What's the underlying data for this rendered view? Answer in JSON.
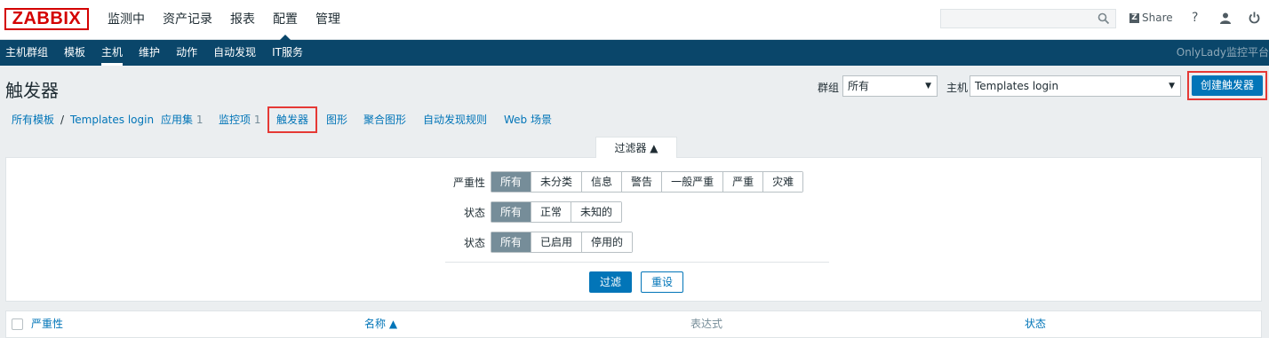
{
  "app": {
    "logo": "ZABBIX",
    "brand_label": "OnlyLady监控平台"
  },
  "top_menu": [
    {
      "label": "监测中"
    },
    {
      "label": "资产记录"
    },
    {
      "label": "报表"
    },
    {
      "label": "配置",
      "active": true
    },
    {
      "label": "管理"
    }
  ],
  "top_right": {
    "search_value": "",
    "share_label": "Share",
    "help_label": "?"
  },
  "sub_menu": [
    {
      "label": "主机群组"
    },
    {
      "label": "模板"
    },
    {
      "label": "主机",
      "active": true
    },
    {
      "label": "维护"
    },
    {
      "label": "动作"
    },
    {
      "label": "自动发现"
    },
    {
      "label": "IT服务"
    }
  ],
  "page": {
    "title": "触发器",
    "group_label": "群组",
    "group_value": "所有",
    "host_label": "主机",
    "host_value": "Templates login",
    "create_button": "创建触发器"
  },
  "breadcrumb": {
    "all_templates": "所有模板",
    "separator": "/",
    "template_name": "Templates login",
    "tabs": [
      {
        "label": "应用集",
        "count": "1"
      },
      {
        "label": "监控项",
        "count": "1"
      },
      {
        "label": "触发器",
        "count": "",
        "active": true
      },
      {
        "label": "图形",
        "count": ""
      },
      {
        "label": "聚合图形",
        "count": ""
      },
      {
        "label": "自动发现规则",
        "count": ""
      },
      {
        "label": "Web 场景",
        "count": ""
      }
    ]
  },
  "filter": {
    "tab_label": "过滤器 ▲",
    "severity": {
      "label": "严重性",
      "options": [
        "所有",
        "未分类",
        "信息",
        "警告",
        "一般严重",
        "严重",
        "灾难"
      ],
      "selected": "所有"
    },
    "state": {
      "label": "状态",
      "options": [
        "所有",
        "正常",
        "未知的"
      ],
      "selected": "所有"
    },
    "status": {
      "label": "状态",
      "options": [
        "所有",
        "已启用",
        "停用的"
      ],
      "selected": "所有"
    },
    "apply_button": "过滤",
    "reset_button": "重设"
  },
  "table": {
    "columns": [
      {
        "label": "严重性",
        "sortable": true
      },
      {
        "label": "名称 ▲",
        "sortable": true
      },
      {
        "label": "表达式",
        "sortable": false
      },
      {
        "label": "状态",
        "sortable": true
      }
    ]
  }
}
